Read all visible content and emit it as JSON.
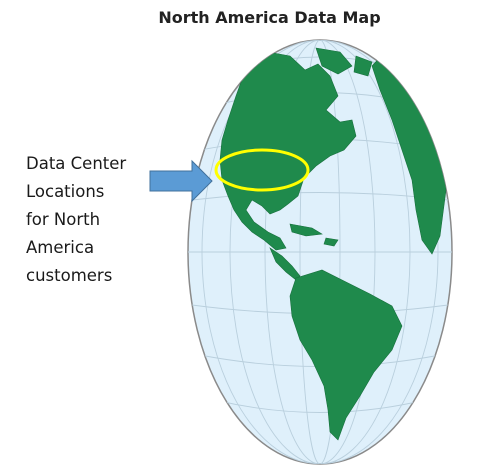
{
  "map": {
    "title": "North America Data Map",
    "callout_lines": [
      "Data Center",
      "Locations",
      "for North",
      "America",
      "customers"
    ]
  },
  "colors": {
    "ocean": "#dff0fb",
    "land": "#1f8a4c",
    "graticule": "#b9cfdd",
    "highlight_ring": "#ffff00",
    "arrow": "#5b9bd5"
  },
  "icons": {
    "arrow": "right-arrow-icon",
    "highlight": "ellipse-highlight"
  }
}
